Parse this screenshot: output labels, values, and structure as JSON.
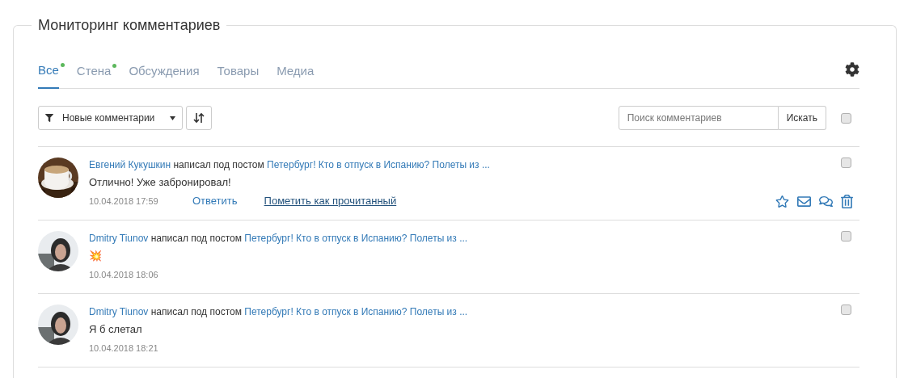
{
  "panel": {
    "title": "Мониторинг комментариев"
  },
  "tabs": [
    {
      "label": "Все",
      "selected": true,
      "has_new": true
    },
    {
      "label": "Стена",
      "selected": false,
      "has_new": true
    },
    {
      "label": "Обсуждения",
      "selected": false,
      "has_new": false
    },
    {
      "label": "Товары",
      "selected": false,
      "has_new": false
    },
    {
      "label": "Медиа",
      "selected": false,
      "has_new": false
    }
  ],
  "filter": {
    "value": "Новые комментарии"
  },
  "search": {
    "placeholder": "Поиск комментариев",
    "button": "Искать"
  },
  "select_all": {
    "checked": false
  },
  "comments": [
    {
      "author": "Евгений Кукушкин",
      "verb": "написал под постом",
      "post": "Петербург! Кто в отпуск в Испанию? Полеты из ...",
      "text": "Отлично! Уже забронировал!",
      "time": "10.04.2018 17:59",
      "reply": "Ответить",
      "mark_read": "Пометить как прочитанный",
      "checked": false
    },
    {
      "author": "Dmitry Tiunov",
      "verb": "написал под постом",
      "post": "Петербург! Кто в отпуск в Испанию? Полеты из ...",
      "text": "💥",
      "time": "10.04.2018 18:06",
      "checked": false
    },
    {
      "author": "Dmitry Tiunov",
      "verb": "написал под постом",
      "post": "Петербург! Кто в отпуск в Испанию? Полеты из ...",
      "text": "Я б слетал",
      "time": "10.04.2018 18:21",
      "checked": false
    }
  ]
}
